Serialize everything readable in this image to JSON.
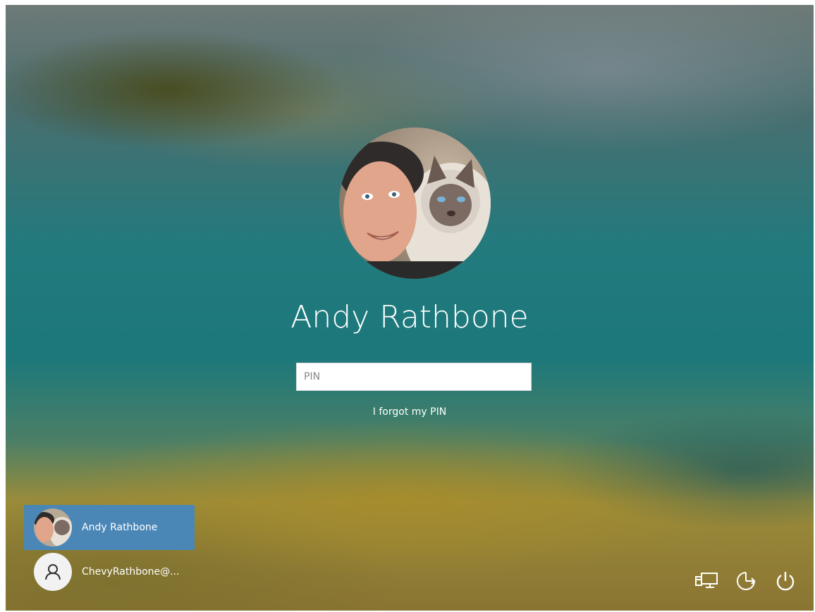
{
  "user": {
    "display_name": "Andy Rathbone",
    "avatar_icon": "user-photo-person-with-cat"
  },
  "pin": {
    "placeholder": "PIN",
    "value": ""
  },
  "links": {
    "forgot_pin": "I forgot my PIN"
  },
  "accounts": [
    {
      "label": "Andy Rathbone",
      "selected": true,
      "avatar_icon": "user-photo-person-with-cat"
    },
    {
      "label": "ChevyRathbone@...",
      "selected": false,
      "avatar_icon": "generic-user-icon"
    }
  ],
  "system_buttons": {
    "network_icon": "network-icon",
    "ease_of_access_icon": "ease-of-access-icon",
    "power_icon": "power-icon"
  },
  "colors": {
    "selected_tile": "#4a87b7",
    "text": "#ffffff"
  }
}
